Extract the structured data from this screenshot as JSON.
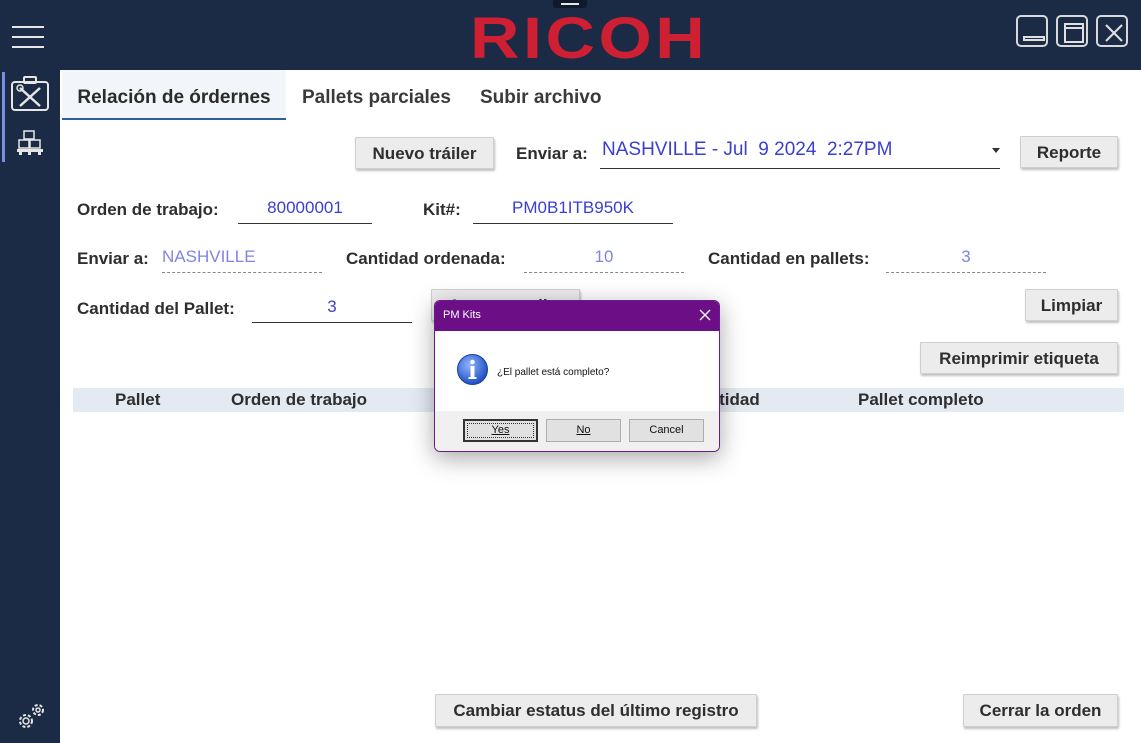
{
  "window": {
    "brand": "RICOH"
  },
  "tabs": [
    {
      "label": "Relación de órdernes",
      "active": true
    },
    {
      "label": "Pallets parciales",
      "active": false
    },
    {
      "label": "Subir archivo",
      "active": false
    }
  ],
  "toolbar": {
    "new_trailer_label": "Nuevo tráiler",
    "send_to_label": "Enviar a:",
    "send_to_value": "NASHVILLE - Jul  9 2024  2:27PM",
    "report_label": "Reporte"
  },
  "form": {
    "work_order_label": "Orden de trabajo:",
    "work_order_value": "80000001",
    "kit_label": "Kit#:",
    "kit_value": "PM0B1ITB950K",
    "send_to_label": "Enviar a:",
    "send_to_value": "NASHVILLE",
    "qty_ordered_label": "Cantidad ordenada:",
    "qty_ordered_value": "10",
    "qty_in_pallets_label": "Cantidad en pallets:",
    "qty_in_pallets_value": "3",
    "pallet_qty_label": "Cantidad del Pallet:",
    "pallet_qty_value": "3",
    "add_pallet_label": "Agregar pallet",
    "clear_label": "Limpiar",
    "reprint_label": "Reimprimir etiqueta"
  },
  "grid": {
    "columns": [
      "Pallet",
      "Orden de trabajo",
      "Cantidad",
      "Pallet completo"
    ]
  },
  "footer": {
    "change_status_label": "Cambiar estatus del último registro",
    "close_order_label": "Cerrar la orden"
  },
  "dialog": {
    "title": "PM Kits",
    "message": "¿El pallet está completo?",
    "yes_label": "Yes",
    "no_label": "No",
    "cancel_label": "Cancel"
  },
  "colors": {
    "brand_red": "#cf1f33",
    "navy": "#1b2a45",
    "field_blue": "#3b3fd0",
    "dialog_purple": "#6c0f86"
  }
}
